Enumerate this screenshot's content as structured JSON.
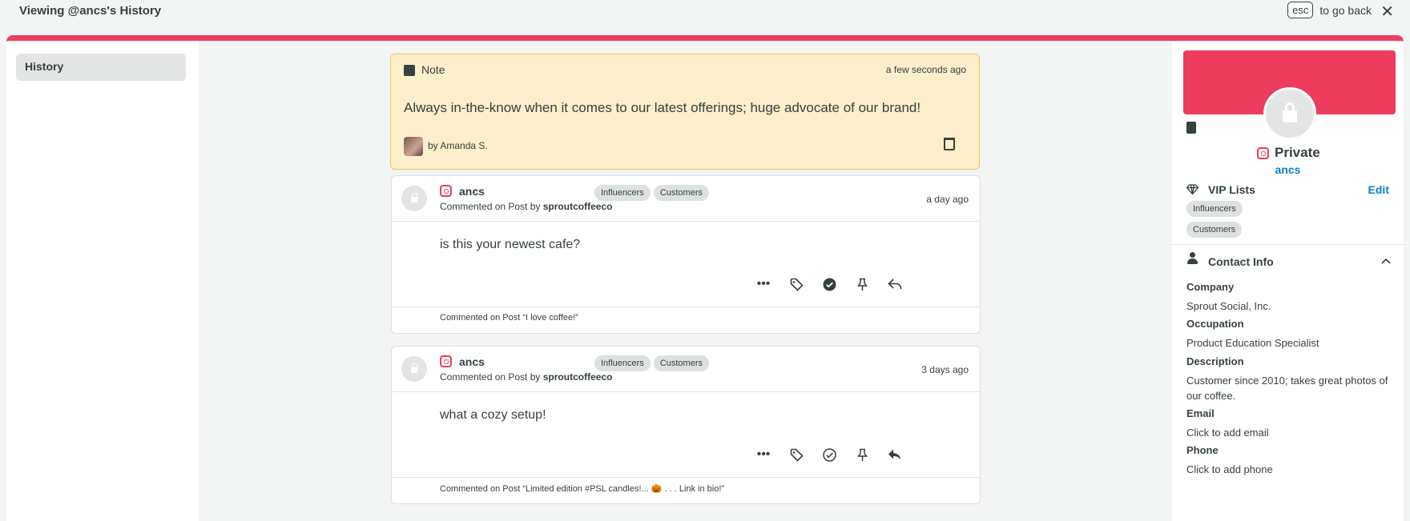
{
  "topbar": {
    "title": "Viewing @ancs's History",
    "esc_key": "esc",
    "esc_hint": "to go back",
    "close_glyph": "✕"
  },
  "nav": {
    "history_label": "History"
  },
  "note": {
    "label": "Note",
    "time": "a few seconds ago",
    "text": "Always in-the-know when it comes to our latest offerings; huge advocate of our brand!",
    "author": "by Amanda S."
  },
  "messages": [
    {
      "handle": "ancs",
      "meta_prefix": "Commented on Post by",
      "meta_account": "sproutcoffeeco",
      "tags": [
        "Influencers",
        "Customers"
      ],
      "time": "a day ago",
      "body": "is this your newest cafe?",
      "footer": "Commented on Post “I love coffee!”",
      "completed": true
    },
    {
      "handle": "ancs",
      "meta_prefix": "Commented on Post by",
      "meta_account": "sproutcoffeeco",
      "tags": [
        "Influencers",
        "Customers"
      ],
      "time": "3 days ago",
      "body": "what a cozy setup!",
      "footer": "Commented on Post “Limited edition #PSL candles!... 🎃 . . . Link in bio!”",
      "completed": false
    }
  ],
  "profile": {
    "privacy": "Private",
    "username": "ancs",
    "vip_title": "VIP Lists",
    "vip_edit": "Edit",
    "vip_tags": [
      "Influencers",
      "Customers"
    ],
    "contact_title": "Contact Info",
    "fields": [
      {
        "label": "Company",
        "value": "Sprout Social, Inc."
      },
      {
        "label": "Occupation",
        "value": "Product Education Specialist"
      },
      {
        "label": "Description",
        "value": "Customer since 2010; takes great photos of our coffee."
      },
      {
        "label": "Email",
        "value": "Click to add email"
      },
      {
        "label": "Phone",
        "value": "Click to add phone"
      }
    ]
  },
  "colors": {
    "brand": "#ed3c5e",
    "link": "#0b7dce",
    "note_bg": "#fdeecc",
    "text": "#364141"
  },
  "icons": [
    "note-icon",
    "trash-icon",
    "lock-icon",
    "instagram-icon",
    "more-icon",
    "tag-icon",
    "complete-icon",
    "pin-icon",
    "reply-icon",
    "clipboard-icon",
    "diamond-icon",
    "person-icon",
    "chevron-up-icon",
    "close-icon"
  ]
}
